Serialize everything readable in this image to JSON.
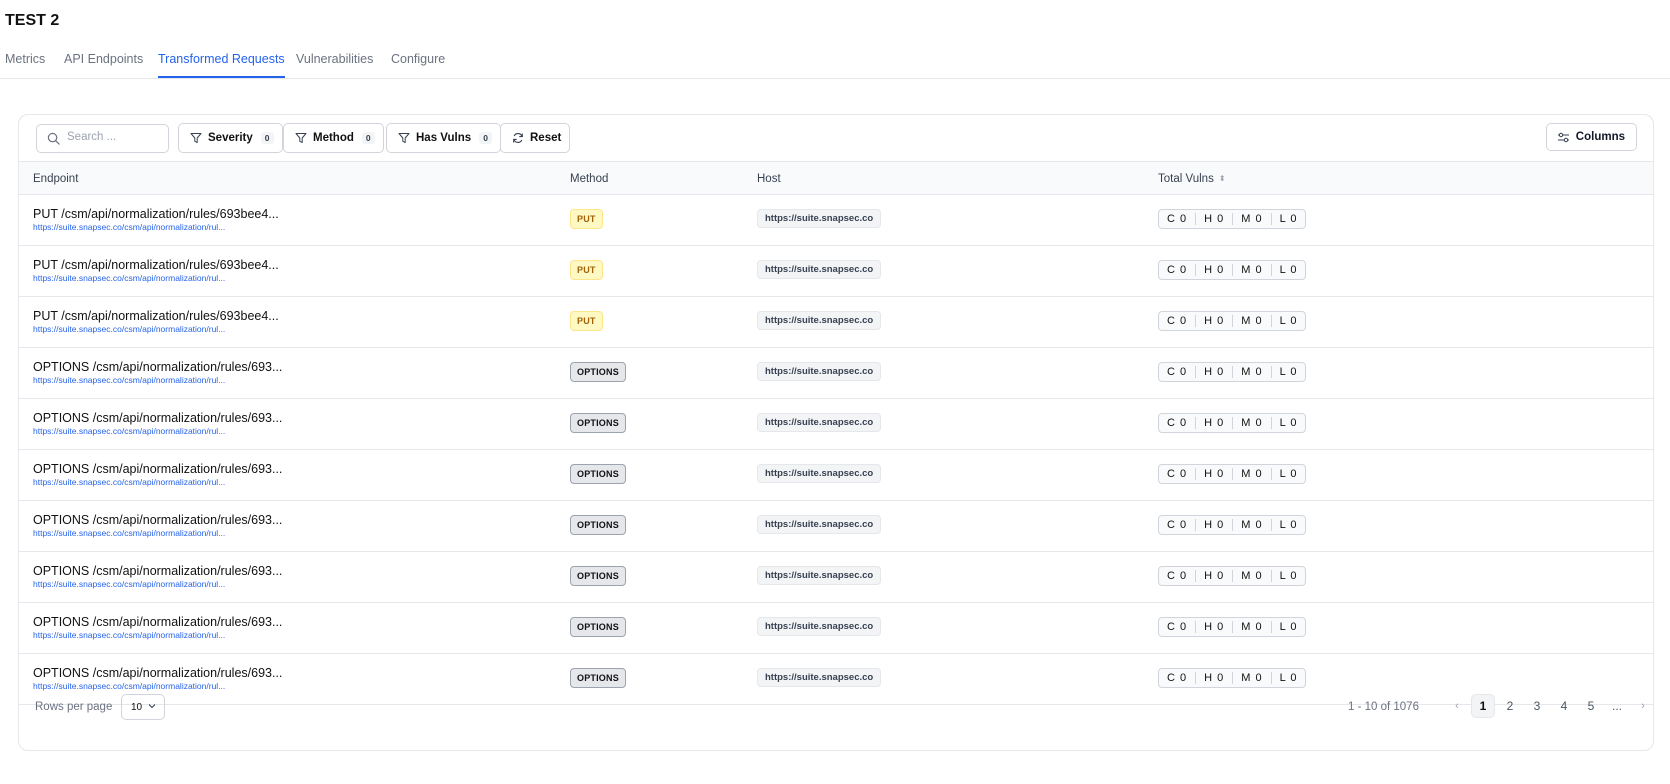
{
  "page": {
    "title": "TEST 2"
  },
  "tabs": [
    {
      "label": "Metrics",
      "active": false
    },
    {
      "label": "API Endpoints",
      "active": false
    },
    {
      "label": "Transformed Requests",
      "active": true
    },
    {
      "label": "Vulnerabilities",
      "active": false
    },
    {
      "label": "Configure",
      "active": false
    }
  ],
  "toolbar": {
    "search_placeholder": "Search ...",
    "filters": [
      {
        "label": "Severity",
        "count": "0"
      },
      {
        "label": "Method",
        "count": "0"
      },
      {
        "label": "Has Vulns",
        "count": "0"
      }
    ],
    "reset_label": "Reset",
    "columns_label": "Columns"
  },
  "table": {
    "headers": {
      "endpoint": "Endpoint",
      "method": "Method",
      "host": "Host",
      "total_vulns": "Total Vulns"
    },
    "rows": [
      {
        "title": "PUT /csm/api/normalization/rules/693bee4...",
        "url": "https://suite.snapsec.co/csm/api/normalization/rul...",
        "method": "PUT",
        "host": "https://suite.snapsec.co",
        "c": "C 0",
        "h": "H 0",
        "m": "M 0",
        "l": "L 0"
      },
      {
        "title": "PUT /csm/api/normalization/rules/693bee4...",
        "url": "https://suite.snapsec.co/csm/api/normalization/rul...",
        "method": "PUT",
        "host": "https://suite.snapsec.co",
        "c": "C 0",
        "h": "H 0",
        "m": "M 0",
        "l": "L 0"
      },
      {
        "title": "PUT /csm/api/normalization/rules/693bee4...",
        "url": "https://suite.snapsec.co/csm/api/normalization/rul...",
        "method": "PUT",
        "host": "https://suite.snapsec.co",
        "c": "C 0",
        "h": "H 0",
        "m": "M 0",
        "l": "L 0"
      },
      {
        "title": "OPTIONS /csm/api/normalization/rules/693...",
        "url": "https://suite.snapsec.co/csm/api/normalization/rul...",
        "method": "OPTIONS",
        "host": "https://suite.snapsec.co",
        "c": "C 0",
        "h": "H 0",
        "m": "M 0",
        "l": "L 0"
      },
      {
        "title": "OPTIONS /csm/api/normalization/rules/693...",
        "url": "https://suite.snapsec.co/csm/api/normalization/rul...",
        "method": "OPTIONS",
        "host": "https://suite.snapsec.co",
        "c": "C 0",
        "h": "H 0",
        "m": "M 0",
        "l": "L 0"
      },
      {
        "title": "OPTIONS /csm/api/normalization/rules/693...",
        "url": "https://suite.snapsec.co/csm/api/normalization/rul...",
        "method": "OPTIONS",
        "host": "https://suite.snapsec.co",
        "c": "C 0",
        "h": "H 0",
        "m": "M 0",
        "l": "L 0"
      },
      {
        "title": "OPTIONS /csm/api/normalization/rules/693...",
        "url": "https://suite.snapsec.co/csm/api/normalization/rul...",
        "method": "OPTIONS",
        "host": "https://suite.snapsec.co",
        "c": "C 0",
        "h": "H 0",
        "m": "M 0",
        "l": "L 0"
      },
      {
        "title": "OPTIONS /csm/api/normalization/rules/693...",
        "url": "https://suite.snapsec.co/csm/api/normalization/rul...",
        "method": "OPTIONS",
        "host": "https://suite.snapsec.co",
        "c": "C 0",
        "h": "H 0",
        "m": "M 0",
        "l": "L 0"
      },
      {
        "title": "OPTIONS /csm/api/normalization/rules/693...",
        "url": "https://suite.snapsec.co/csm/api/normalization/rul...",
        "method": "OPTIONS",
        "host": "https://suite.snapsec.co",
        "c": "C 0",
        "h": "H 0",
        "m": "M 0",
        "l": "L 0"
      },
      {
        "title": "OPTIONS /csm/api/normalization/rules/693...",
        "url": "https://suite.snapsec.co/csm/api/normalization/rul...",
        "method": "OPTIONS",
        "host": "https://suite.snapsec.co",
        "c": "C 0",
        "h": "H 0",
        "m": "M 0",
        "l": "L 0"
      }
    ]
  },
  "footer": {
    "rows_per_page_label": "Rows per page",
    "rows_per_page_value": "10",
    "range_text": "1 - 10 of 1076",
    "pages": [
      "1",
      "2",
      "3",
      "4",
      "5",
      "..."
    ],
    "current_page": "1",
    "prev_symbol": "‹",
    "next_symbol": "›"
  },
  "colors": {
    "accent": "#2563eb",
    "put_badge_bg": "#fef9c3",
    "put_badge_text": "#a16207",
    "options_badge_bg": "#e5e7eb"
  }
}
